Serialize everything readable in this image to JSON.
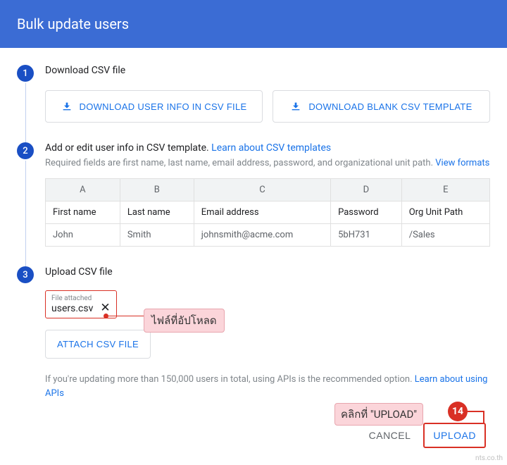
{
  "header": {
    "title": "Bulk update users"
  },
  "steps": {
    "s1": {
      "num": "1",
      "title": "Download CSV file",
      "btn_info": "DOWNLOAD USER INFO IN CSV FILE",
      "btn_blank": "DOWNLOAD BLANK CSV TEMPLATE"
    },
    "s2": {
      "num": "2",
      "title_a": "Add or edit user info in CSV template. ",
      "title_link": "Learn about CSV templates",
      "sub_a": "Required fields are first name, last name, email address, password, and organizational unit path. ",
      "sub_link": "View formats",
      "cols": {
        "a": "A",
        "b": "B",
        "c": "C",
        "d": "D",
        "e": "E"
      },
      "fields": {
        "a": "First name",
        "b": "Last name",
        "c": "Email address",
        "d": "Password",
        "e": "Org Unit Path"
      },
      "row": {
        "a": "John",
        "b": "Smith",
        "c": "johnsmith@acme.com",
        "d": "5bH731",
        "e": "/Sales"
      }
    },
    "s3": {
      "num": "3",
      "title": "Upload CSV file",
      "chip_label": "File attached",
      "chip_name": "users.csv",
      "btn_attach": "ATTACH CSV FILE",
      "help_a": "If you're updating more than 150,000 users in total, using APIs is the recommended option. ",
      "help_link": "Learn about using APIs"
    }
  },
  "annotations": {
    "callout1": "ไฟล์ที่อัปโหลด",
    "callout2": "คลิกที่ \"UPLOAD\"",
    "badge": "14"
  },
  "footer": {
    "cancel": "CANCEL",
    "upload": "UPLOAD"
  },
  "watermark": "nts.co.th"
}
